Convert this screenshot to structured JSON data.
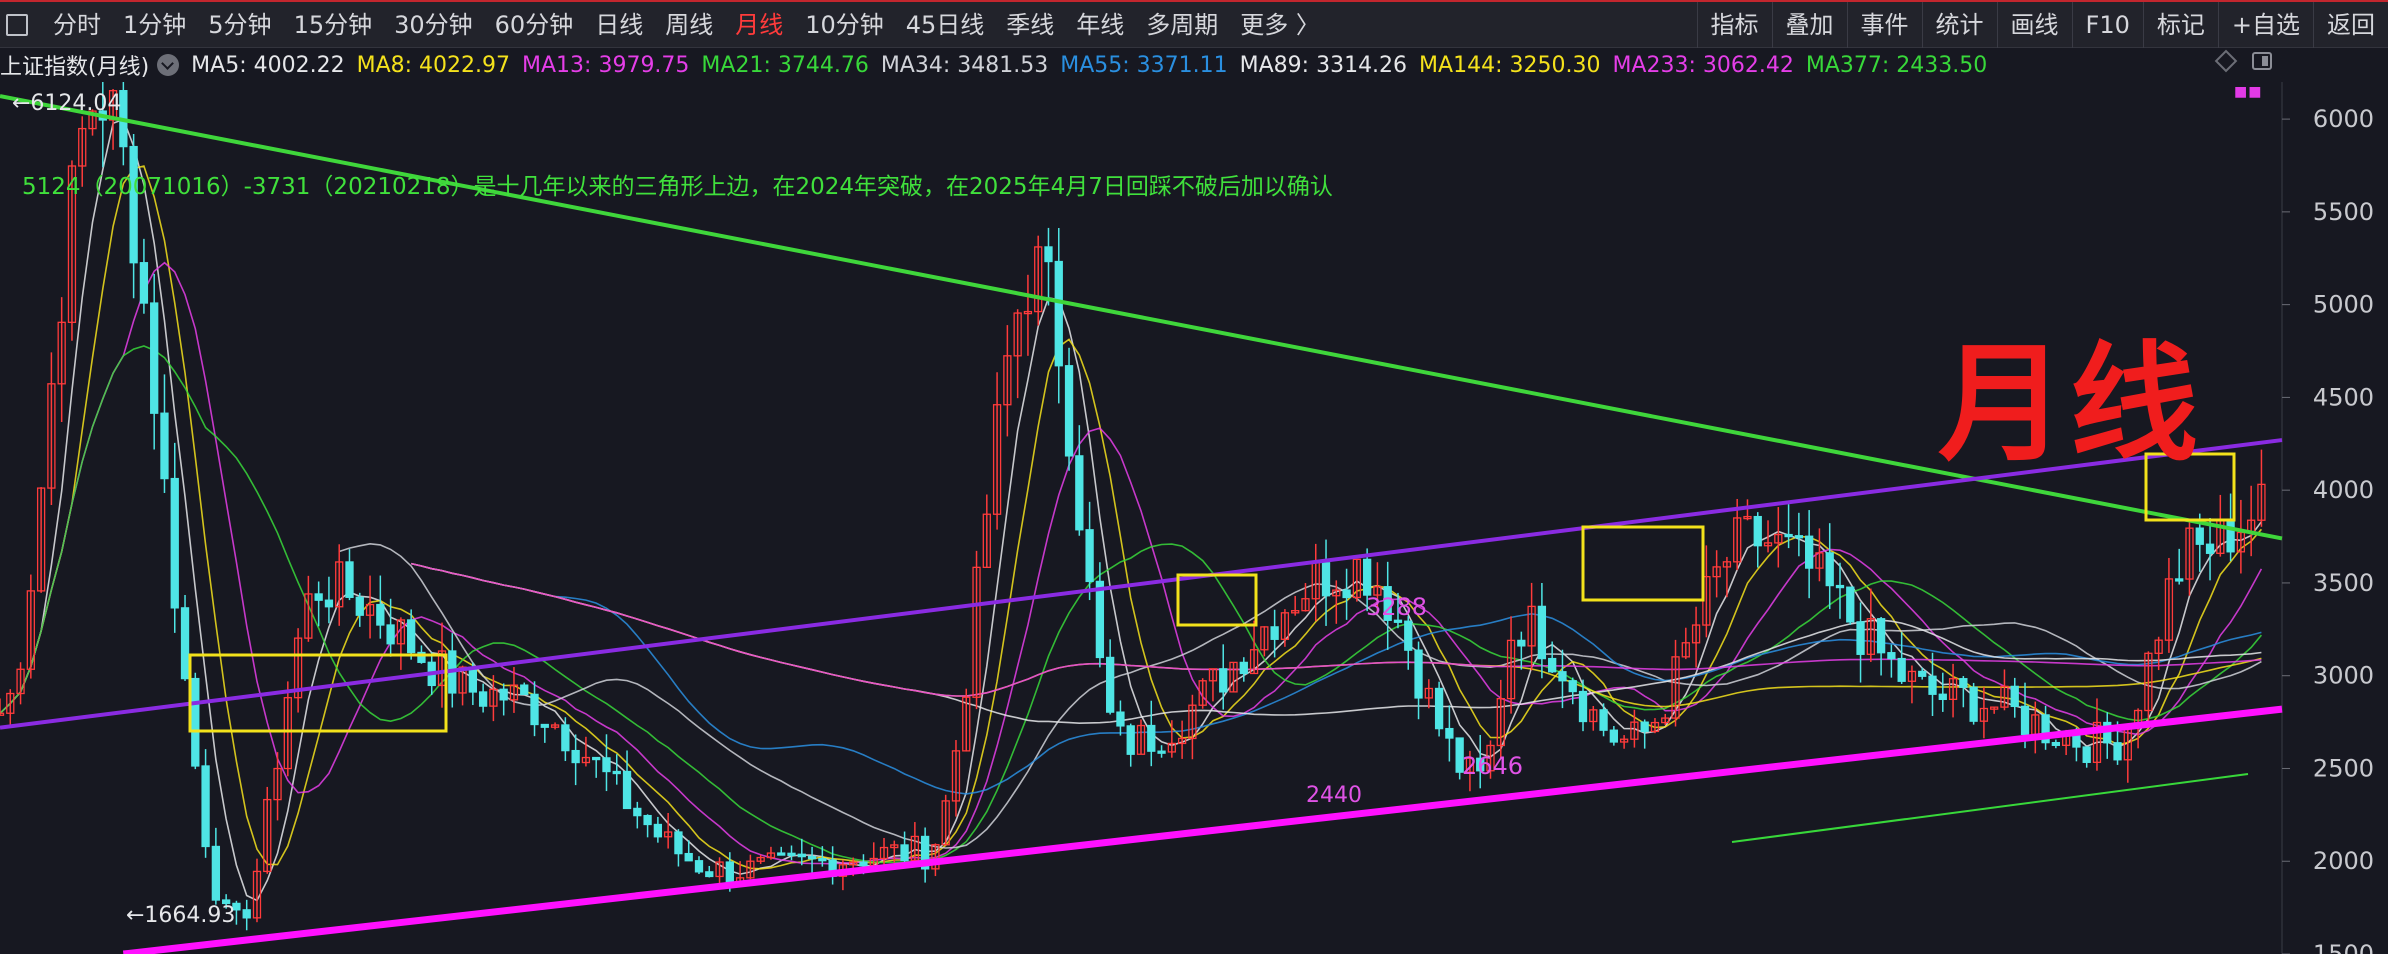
{
  "period_tabs": [
    {
      "label": "分时"
    },
    {
      "label": "1分钟"
    },
    {
      "label": "5分钟"
    },
    {
      "label": "15分钟"
    },
    {
      "label": "30分钟"
    },
    {
      "label": "60分钟"
    },
    {
      "label": "日线"
    },
    {
      "label": "周线"
    },
    {
      "label": "月线"
    },
    {
      "label": "10分钟"
    },
    {
      "label": "45日线"
    },
    {
      "label": "季线"
    },
    {
      "label": "年线"
    },
    {
      "label": "多周期"
    },
    {
      "label": "更多 〉"
    }
  ],
  "active_period": "月线",
  "tool_tabs": [
    {
      "label": "指标"
    },
    {
      "label": "叠加"
    },
    {
      "label": "事件"
    },
    {
      "label": "统计"
    },
    {
      "label": "画线"
    },
    {
      "label": "F10"
    },
    {
      "label": "标记"
    },
    {
      "label": "+自选"
    },
    {
      "label": "返回"
    }
  ],
  "chart_title": "上证指数(月线)",
  "ma_legend": [
    {
      "label": "MA5: 4002.22",
      "color": "#e6e7ea"
    },
    {
      "label": "MA8: 4022.97",
      "color": "#f5e21c"
    },
    {
      "label": "MA13: 3979.75",
      "color": "#e53ee8"
    },
    {
      "label": "MA21: 3744.76",
      "color": "#38d83a"
    },
    {
      "label": "MA34: 3481.53",
      "color": "#d0d2d8"
    },
    {
      "label": "MA55: 3371.11",
      "color": "#2a8fe0"
    },
    {
      "label": "MA89: 3314.26",
      "color": "#e6e7ea"
    },
    {
      "label": "MA144: 3250.30",
      "color": "#f5e21c"
    },
    {
      "label": "MA233: 3062.42",
      "color": "#e53ee8"
    },
    {
      "label": "MA377: 2433.50",
      "color": "#38d83a"
    }
  ],
  "annotation": "5124（20071016）-3731（20210218）是十几年以来的三角形上边，在2024年突破，在2025年4月7日回踩不破后加以确认",
  "big_label": "月线",
  "marks": {
    "high": "←6124.04",
    "low": "←1664.93",
    "p3288": "3288",
    "p2440": "2440",
    "p2646": "2646"
  },
  "chart_data": {
    "type": "candlestick",
    "x_range": [
      2007,
      2025.5
    ],
    "y_range": [
      1500,
      6200
    ],
    "y_ticks": [
      1500,
      2000,
      2500,
      3000,
      3500,
      4000,
      4500,
      5000,
      5500,
      6000
    ],
    "up_color": "#ff3b3b",
    "down_color": "#4fe5e5",
    "series": [
      {
        "date": 2007.0,
        "close": 2800
      },
      {
        "date": 2007.8,
        "close": 6124
      },
      {
        "date": 2008.9,
        "close": 1665
      },
      {
        "date": 2009.6,
        "close": 3478
      },
      {
        "date": 2011.0,
        "close": 2900
      },
      {
        "date": 2012.9,
        "close": 1950
      },
      {
        "date": 2014.5,
        "close": 2050
      },
      {
        "date": 2015.4,
        "close": 5178
      },
      {
        "date": 2016.1,
        "close": 2638
      },
      {
        "date": 2018.0,
        "close": 3587
      },
      {
        "date": 2019.0,
        "close": 2440
      },
      {
        "date": 2019.3,
        "close": 3288
      },
      {
        "date": 2020.2,
        "close": 2646
      },
      {
        "date": 2021.2,
        "close": 3731
      },
      {
        "date": 2022.8,
        "close": 2885
      },
      {
        "date": 2024.1,
        "close": 2635
      },
      {
        "date": 2024.8,
        "close": 3674
      },
      {
        "date": 2025.4,
        "close": 3900
      }
    ],
    "trend_lines": [
      {
        "name": "三角形上边",
        "color": "#3fd63b",
        "from": [
          2007.0,
          6124
        ],
        "to": [
          2025.5,
          3740
        ]
      },
      {
        "color": "#8a2be2",
        "from": [
          2007.0,
          2720
        ],
        "to": [
          2025.5,
          4270
        ]
      },
      {
        "color": "#ff10ff",
        "from": [
          2008.0,
          1500
        ],
        "to": [
          2025.5,
          2820
        ]
      }
    ]
  }
}
